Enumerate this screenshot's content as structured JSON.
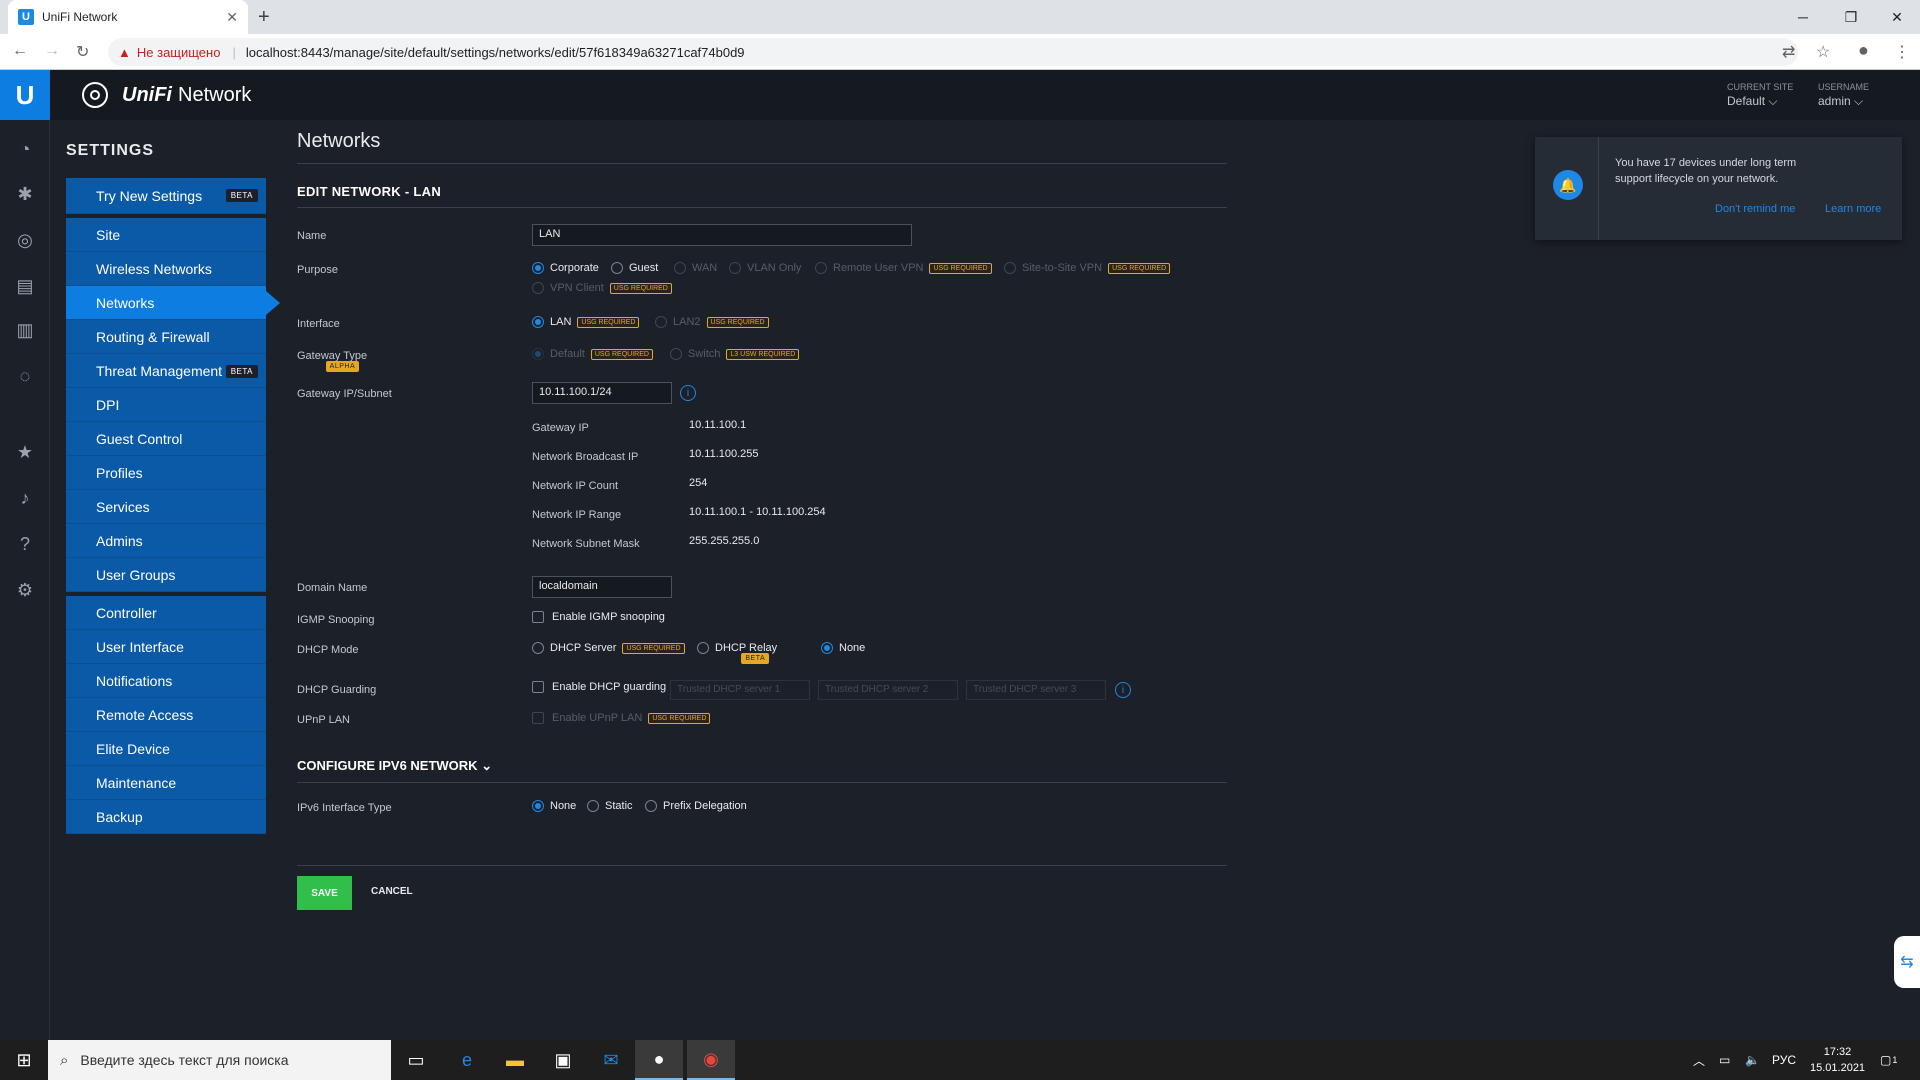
{
  "browser": {
    "tab_title": "UniFi Network",
    "tab_favicon": "U",
    "insecure_label": "Не защищено",
    "url": "localhost:8443/manage/site/default/settings/networks/edit/57f618349a63271caf74b0d9"
  },
  "header": {
    "brand_unifi": "UniFi",
    "brand_network": "Network",
    "current_site_label": "CURRENT SITE",
    "current_site_value": "Default",
    "username_label": "USERNAME",
    "username_value": "admin"
  },
  "sidebar": {
    "title": "SETTINGS",
    "try_new": "Try New Settings",
    "beta": "BETA",
    "items": [
      {
        "label": "Site"
      },
      {
        "label": "Wireless Networks"
      },
      {
        "label": "Networks"
      },
      {
        "label": "Routing & Firewall"
      },
      {
        "label": "Threat Management"
      },
      {
        "label": "DPI"
      },
      {
        "label": "Guest Control"
      },
      {
        "label": "Profiles"
      },
      {
        "label": "Services"
      },
      {
        "label": "Admins"
      },
      {
        "label": "User Groups"
      }
    ],
    "items2": [
      {
        "label": "Controller"
      },
      {
        "label": "User Interface"
      },
      {
        "label": "Notifications"
      },
      {
        "label": "Remote Access"
      },
      {
        "label": "Elite Device"
      },
      {
        "label": "Maintenance"
      },
      {
        "label": "Backup"
      }
    ]
  },
  "main": {
    "title": "Networks",
    "subtitle": "EDIT NETWORK - LAN",
    "labels": {
      "name": "Name",
      "purpose": "Purpose",
      "interface": "Interface",
      "gateway_type": "Gateway Type",
      "gateway_subnet": "Gateway IP/Subnet",
      "gateway_ip": "Gateway IP",
      "broadcast_ip": "Network Broadcast IP",
      "ip_count": "Network IP Count",
      "ip_range": "Network IP Range",
      "subnet_mask": "Network Subnet Mask",
      "domain_name": "Domain Name",
      "igmp": "IGMP Snooping",
      "dhcp_mode": "DHCP Mode",
      "dhcp_guarding": "DHCP Guarding",
      "upnp": "UPnP LAN",
      "ipv6_type": "IPv6 Interface Type"
    },
    "values": {
      "name": "LAN",
      "gateway_subnet": "10.11.100.1/24",
      "gateway_ip": "10.11.100.1",
      "broadcast_ip": "10.11.100.255",
      "ip_count": "254",
      "ip_range": "10.11.100.1 - 10.11.100.254",
      "subnet_mask": "255.255.255.0",
      "domain_name": "localdomain"
    },
    "purpose_opts": {
      "corporate": "Corporate",
      "guest": "Guest",
      "wan": "WAN",
      "vlan_only": "VLAN Only",
      "remote_vpn": "Remote User VPN",
      "site_vpn": "Site-to-Site VPN",
      "vpn_client": "VPN Client"
    },
    "tags": {
      "usg": "USG REQUIRED",
      "alpha": "ALPHA",
      "l3": "L3 USW REQUIRED",
      "beta": "BETA"
    },
    "interface_opts": {
      "lan": "LAN",
      "lan2": "LAN2"
    },
    "gateway_type_opts": {
      "default": "Default",
      "switch": "Switch"
    },
    "igmp_opt": "Enable IGMP snooping",
    "dhcp_opts": {
      "server": "DHCP Server",
      "relay": "DHCP Relay",
      "none": "None"
    },
    "guard_opt": "Enable DHCP guarding",
    "guard_placeholders": [
      "Trusted DHCP server 1",
      "Trusted DHCP server 2",
      "Trusted DHCP server 3"
    ],
    "upnp_opt": "Enable UPnP LAN",
    "ipv6_title": "CONFIGURE IPV6 NETWORK",
    "ipv6_opts": {
      "none": "None",
      "static": "Static",
      "pd": "Prefix Delegation"
    },
    "save": "SAVE",
    "cancel": "CANCEL"
  },
  "notification": {
    "message": "You have 17 devices under long term support lifecycle on your network.",
    "dont_remind": "Don't remind me",
    "learn_more": "Learn more"
  },
  "taskbar": {
    "search_placeholder": "Введите здесь текст для поиска",
    "lang": "РУС",
    "time": "17:32",
    "date": "15.01.2021",
    "notif_count": "1"
  }
}
